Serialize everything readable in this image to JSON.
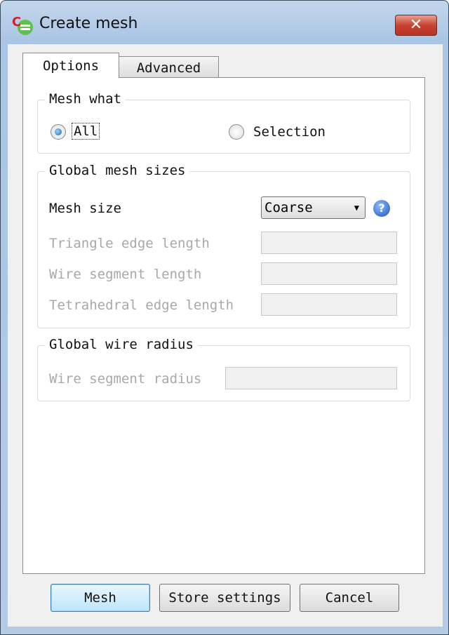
{
  "window": {
    "title": "Create mesh",
    "close_label": "✕"
  },
  "tabs": [
    {
      "label": "Options",
      "active": true
    },
    {
      "label": "Advanced",
      "active": false
    }
  ],
  "mesh_what": {
    "title": "Mesh what",
    "options": [
      {
        "label": "All",
        "selected": true
      },
      {
        "label": "Selection",
        "selected": false
      }
    ]
  },
  "global_mesh_sizes": {
    "title": "Global mesh sizes",
    "mesh_size_label": "Mesh size",
    "mesh_size_value": "Coarse",
    "help": "?",
    "fields": [
      {
        "label": "Triangle edge length",
        "value": ""
      },
      {
        "label": "Wire segment length",
        "value": ""
      },
      {
        "label": "Tetrahedral edge length",
        "value": ""
      }
    ]
  },
  "global_wire_radius": {
    "title": "Global wire radius",
    "fields": [
      {
        "label": "Wire segment radius",
        "value": ""
      }
    ]
  },
  "buttons": {
    "mesh": "Mesh",
    "store": "Store settings",
    "cancel": "Cancel"
  }
}
